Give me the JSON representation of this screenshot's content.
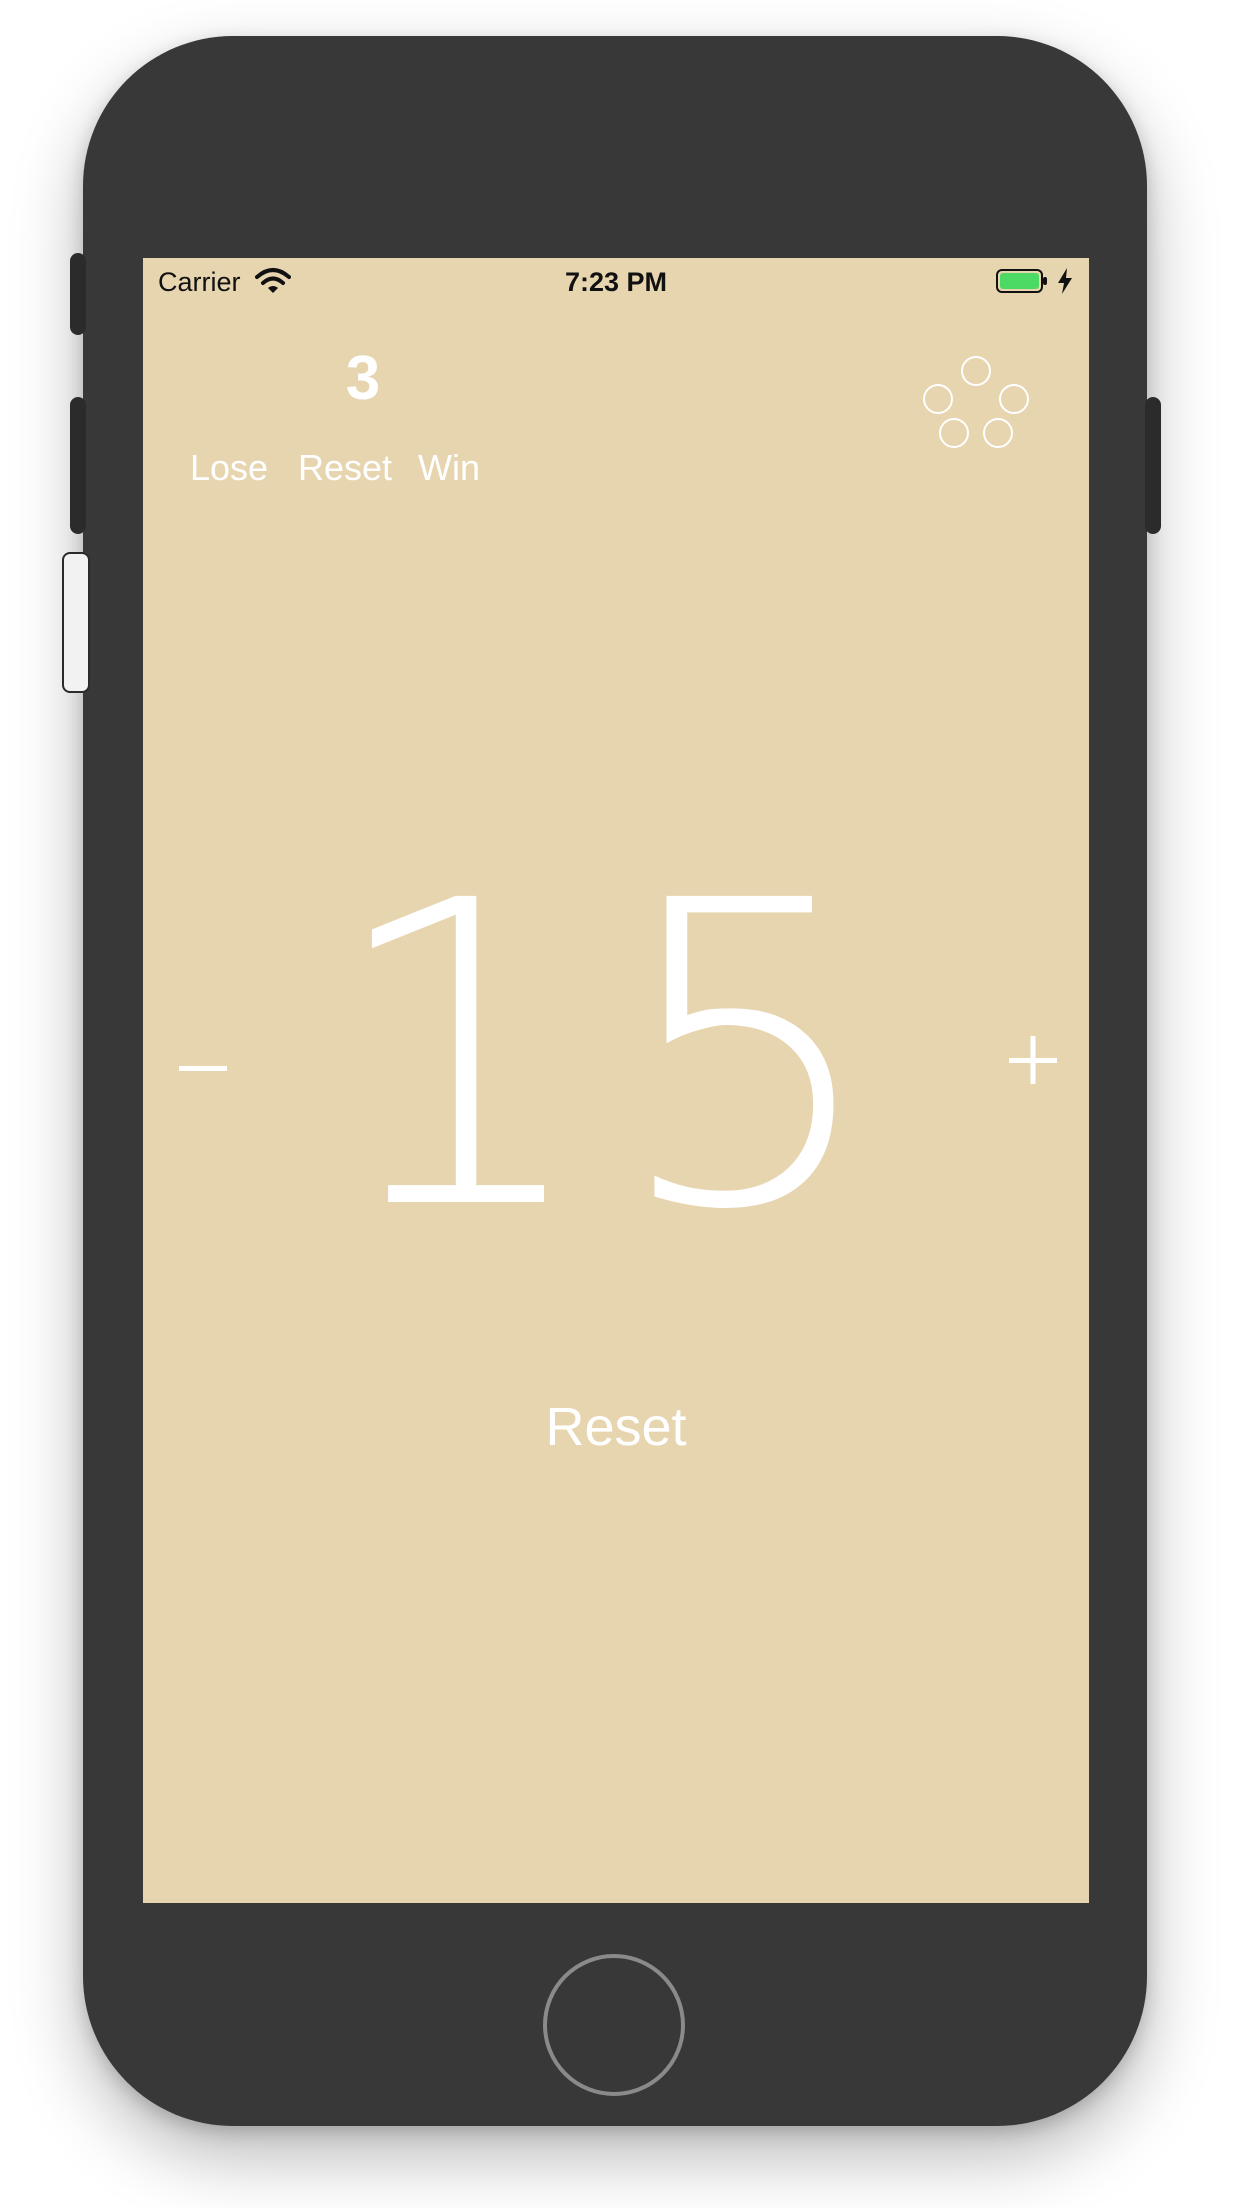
{
  "status_bar": {
    "carrier": "Carrier",
    "time": "7:23 PM"
  },
  "score": {
    "value": "3"
  },
  "controls": {
    "lose_label": "Lose",
    "reset_label": "Reset",
    "win_label": "Win"
  },
  "counter": {
    "value": "15",
    "reset_label": "Reset"
  },
  "icons": {
    "menu": "five-circles-icon",
    "minus": "minus-icon",
    "plus": "plus-icon",
    "wifi": "wifi-icon",
    "battery": "battery-icon",
    "charging": "lightning-bolt-icon"
  },
  "colors": {
    "screen_background": "#e7d5b0",
    "foreground": "#ffffff",
    "phone_body": "#383838",
    "battery_fill": "#4cd964"
  }
}
